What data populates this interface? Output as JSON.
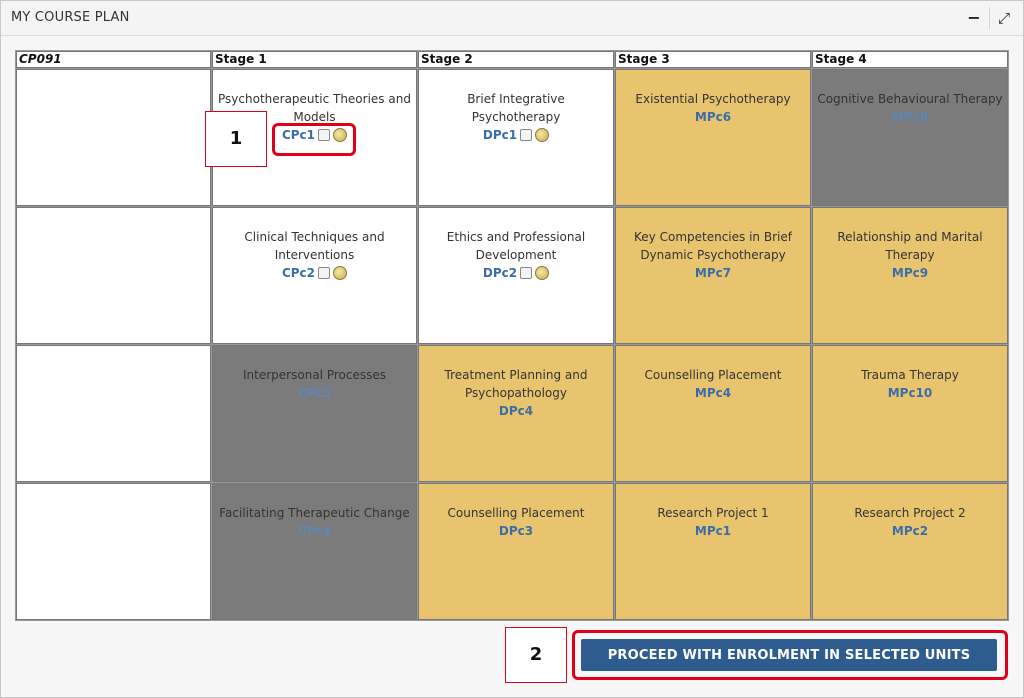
{
  "panel": {
    "title": "MY COURSE PLAN",
    "minimize_label": "−",
    "maximize_label": "⤢"
  },
  "grid": {
    "headers": [
      "CP091",
      "Stage 1",
      "Stage 2",
      "Stage 3",
      "Stage 4"
    ],
    "rows": [
      [
        {
          "name": "Psychotherapeutic Theories and Models",
          "code": "CPc1",
          "state": "available"
        },
        {
          "name": "Brief Integrative Psychotherapy",
          "code": "DPc1",
          "state": "available"
        },
        {
          "name": "Existential Psychotherapy",
          "code": "MPc6",
          "state": "planned"
        },
        {
          "name": "Cognitive Behavioural Therapy",
          "code": "MPc8",
          "state": "unavailable"
        }
      ],
      [
        {
          "name": "Clinical Techniques and Interventions",
          "code": "CPc2",
          "state": "available"
        },
        {
          "name": "Ethics and Professional Development",
          "code": "DPc2",
          "state": "available"
        },
        {
          "name": "Key Competencies in Brief Dynamic Psychotherapy",
          "code": "MPc7",
          "state": "planned"
        },
        {
          "name": "Relationship and Marital Therapy",
          "code": "MPc9",
          "state": "planned"
        }
      ],
      [
        {
          "name": "Interpersonal Processes",
          "code": "CPc3",
          "state": "unavailable"
        },
        {
          "name": "Treatment Planning and Psychopathology",
          "code": "DPc4",
          "state": "planned"
        },
        {
          "name": "Counselling Placement",
          "code": "MPc4",
          "state": "planned"
        },
        {
          "name": "Trauma Therapy",
          "code": "MPc10",
          "state": "planned"
        }
      ],
      [
        {
          "name": "Facilitating Therapeutic Change",
          "code": "CPc4",
          "state": "unavailable"
        },
        {
          "name": "Counselling Placement",
          "code": "DPc3",
          "state": "planned"
        },
        {
          "name": "Research Project 1",
          "code": "MPc1",
          "state": "planned"
        },
        {
          "name": "Research Project 2",
          "code": "MPc2",
          "state": "planned"
        }
      ]
    ]
  },
  "callouts": [
    "1",
    "2"
  ],
  "proceed_label": "PROCEED WITH ENROLMENT IN SELECTED UNITS",
  "colors": {
    "available": "#ffffff",
    "planned": "#e9c46f",
    "unavailable": "#7b7b7b",
    "accent": "#2f5c8f",
    "highlight": "#e1001a"
  }
}
